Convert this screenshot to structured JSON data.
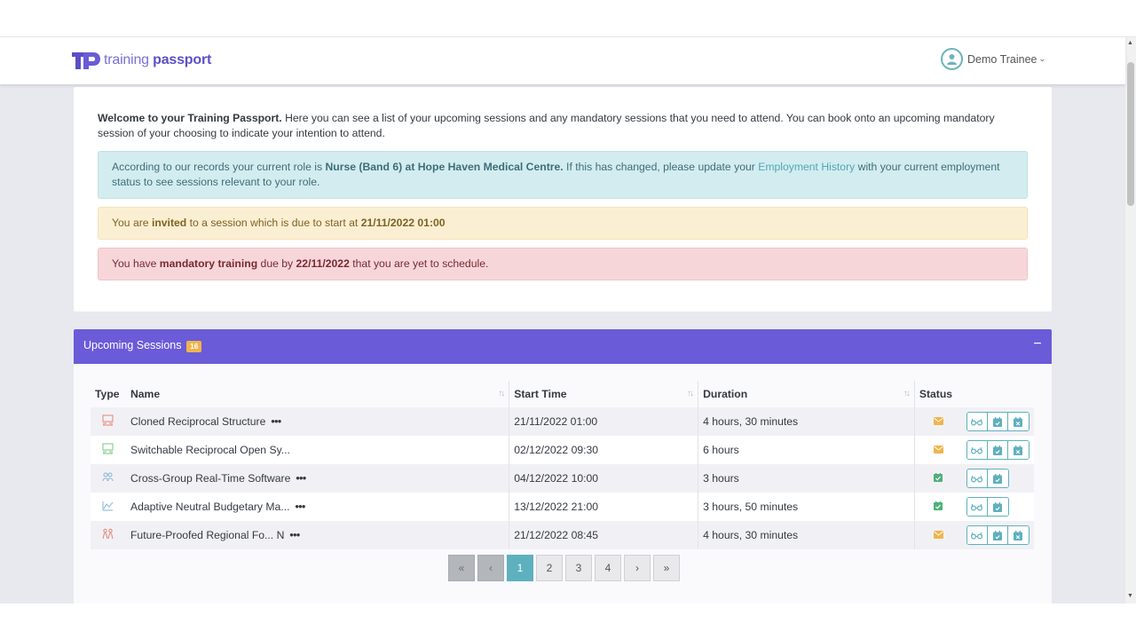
{
  "brand": {
    "name_part1": "training",
    "name_part2": "passport"
  },
  "user_menu": {
    "name": "Demo Trainee"
  },
  "welcome": {
    "intro_bold": "Welcome to your Training Passport.",
    "intro_rest": " Here you can see a list of your upcoming sessions and any mandatory sessions that you need to attend. You can book onto an upcoming mandatory session of your choosing to indicate your intention to attend."
  },
  "alerts": {
    "info": {
      "pre": "According to our records your current role is ",
      "role_bold": "Nurse (Band 6) at Hope Haven Medical Centre.",
      "mid": " If this has changed, please update your ",
      "link": "Employment History",
      "post": " with your current employment status to see sessions relevant to your role."
    },
    "warning": {
      "pre": "You are ",
      "bold1": "invited",
      "mid": " to a session which is due to start at ",
      "bold2": "21/11/2022 01:00"
    },
    "danger": {
      "pre": "You have ",
      "bold1": "mandatory training",
      "mid": " due by ",
      "bold2": "22/11/2022",
      "post": " that you are yet to schedule."
    }
  },
  "sessions": {
    "title": "Upcoming Sessions",
    "count": "16",
    "collapse_symbol": "−",
    "columns": {
      "type": "Type",
      "name": "Name",
      "start": "Start Time",
      "duration": "Duration",
      "status": "Status"
    },
    "rows": [
      {
        "type_icon": "classroom-icon",
        "type_color": "#e8837a",
        "name": "Cloned Reciprocal Structure",
        "more": "•••",
        "start": "21/11/2022 01:00",
        "duration": "4 hours, 30 minutes",
        "status_icon": "envelope-icon",
        "actions": 3
      },
      {
        "type_icon": "classroom-icon",
        "type_color": "#7bc47f",
        "name": "Switchable Reciprocal Open Sy...",
        "more": "",
        "start": "02/12/2022 09:30",
        "duration": "6 hours",
        "status_icon": "envelope-icon",
        "actions": 3
      },
      {
        "type_icon": "group-icon",
        "type_color": "#7fb6d6",
        "name": "Cross-Group Real-Time Software",
        "more": "•••",
        "start": "04/12/2022 10:00",
        "duration": "3 hours",
        "status_icon": "calendar-check-icon",
        "actions": 2
      },
      {
        "type_icon": "chart-icon",
        "type_color": "#7fb6d6",
        "name": "Adaptive Neutral Budgetary Ma...",
        "more": "•••",
        "start": "13/12/2022 21:00",
        "duration": "3 hours, 50 minutes",
        "status_icon": "calendar-check-icon",
        "actions": 2
      },
      {
        "type_icon": "people-icon",
        "type_color": "#e8837a",
        "name": "Future-Proofed Regional Fo... N",
        "more": "•••",
        "start": "21/12/2022 08:45",
        "duration": "4 hours, 30 minutes",
        "status_icon": "envelope-icon",
        "actions": 3
      }
    ]
  },
  "pagination": {
    "first": "«",
    "prev": "‹",
    "pages": [
      "1",
      "2",
      "3",
      "4"
    ],
    "current": "1",
    "next": "›",
    "last": "»"
  },
  "colors": {
    "brand": "#6a5bd8",
    "accent_teal": "#5eb0be",
    "status_envelope": "#f0b44c",
    "status_calendar": "#4fb07a"
  }
}
